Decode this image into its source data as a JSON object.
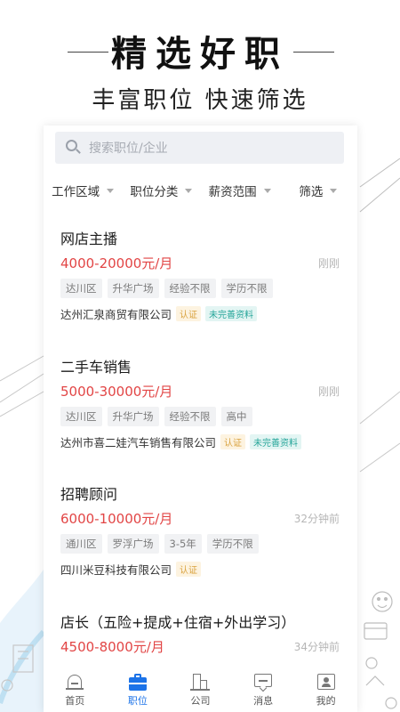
{
  "hero": {
    "title": "精选好职",
    "subtitle": "丰富职位 快速筛选"
  },
  "search": {
    "placeholder": "搜索职位/企业",
    "icon": "search-icon"
  },
  "filters": [
    {
      "label": "工作区域"
    },
    {
      "label": "职位分类"
    },
    {
      "label": "薪资范围"
    },
    {
      "label": "筛选"
    }
  ],
  "jobs": [
    {
      "title": "网店主播",
      "salary": "4000-20000元/月",
      "time": "刚刚",
      "tags": [
        "达川区",
        "升华广场",
        "经验不限",
        "学历不限"
      ],
      "company": "达州汇泉商贸有限公司",
      "badges": [
        "认证",
        "未完善资料"
      ]
    },
    {
      "title": "二手车销售",
      "salary": "5000-30000元/月",
      "time": "刚刚",
      "tags": [
        "达川区",
        "升华广场",
        "经验不限",
        "高中"
      ],
      "company": "达州市喜二娃汽车销售有限公司",
      "badges": [
        "认证",
        "未完善资料"
      ]
    },
    {
      "title": "招聘顾问",
      "salary": "6000-10000元/月",
      "time": "32分钟前",
      "tags": [
        "通川区",
        "罗浮广场",
        "3-5年",
        "学历不限"
      ],
      "company": "四川米豆科技有限公司",
      "badges": [
        "认证"
      ]
    },
    {
      "title": "店长（五险+提成+住宿+外出学习）",
      "salary": "4500-8000元/月",
      "time": "34分钟前",
      "tags": [],
      "company": "",
      "badges": []
    }
  ],
  "tabbar": [
    {
      "label": "首页",
      "icon": "home-icon",
      "active": false
    },
    {
      "label": "职位",
      "icon": "briefcase-icon",
      "active": true
    },
    {
      "label": "公司",
      "icon": "building-icon",
      "active": false
    },
    {
      "label": "消息",
      "icon": "message-icon",
      "active": false
    },
    {
      "label": "我的",
      "icon": "profile-icon",
      "active": false
    }
  ],
  "colors": {
    "accent": "#1c73e8",
    "salary": "#e24545",
    "badge_auth": "#d9a23e",
    "badge_info": "#27a69a"
  }
}
